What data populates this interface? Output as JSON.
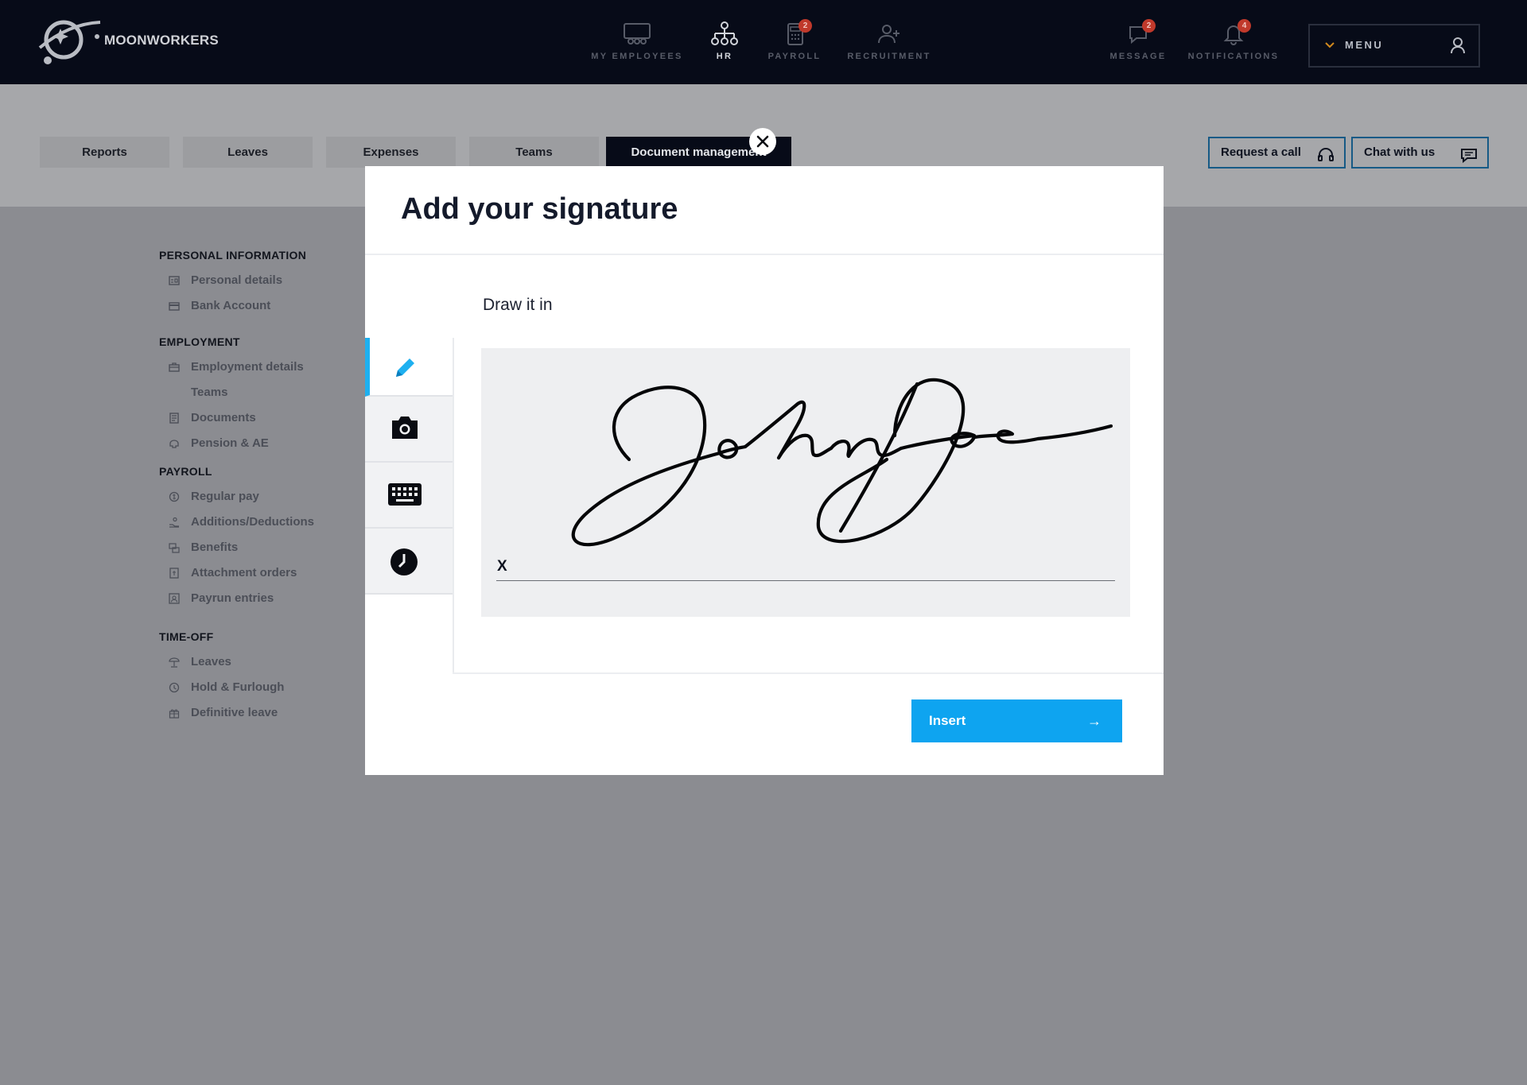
{
  "brand": {
    "name": "MOONWORKERS"
  },
  "top_nav": [
    {
      "id": "employees",
      "label": "MY EMPLOYEES",
      "icon": "team-icon",
      "badge": ""
    },
    {
      "id": "hr",
      "label": "HR",
      "icon": "org-chart-icon",
      "badge": "",
      "active": true
    },
    {
      "id": "payroll",
      "label": "PAYROLL",
      "icon": "calculator-icon",
      "badge": "2"
    },
    {
      "id": "recruitment",
      "label": "RECRUITMENT",
      "icon": "add-user-icon",
      "badge": ""
    }
  ],
  "utility_nav": [
    {
      "id": "message",
      "label": "MESSAGE",
      "icon": "chat-bubble-icon",
      "badge": "2"
    },
    {
      "id": "notifications",
      "label": "NOTIFICATIONS",
      "icon": "bell-icon",
      "badge": "4"
    }
  ],
  "menu": {
    "label": "MENU"
  },
  "tabs": [
    {
      "label": "Reports"
    },
    {
      "label": "Leaves"
    },
    {
      "label": "Expenses"
    },
    {
      "label": "Teams"
    },
    {
      "label": "Document management",
      "active": true
    }
  ],
  "cta": {
    "request_call": "Request a call",
    "chat": "Chat with us"
  },
  "sidebar": {
    "sections": [
      {
        "heading": "PERSONAL INFORMATION",
        "items": [
          "Personal details",
          "Bank Account"
        ]
      },
      {
        "heading": "EMPLOYMENT",
        "items": [
          "Employment details",
          "Teams",
          "Documents",
          "Pension & AE"
        ]
      },
      {
        "heading": "PAYROLL",
        "items": [
          "Regular pay",
          "Additions/Deductions",
          "Benefits",
          "Attachment orders",
          "Payrun entries"
        ]
      },
      {
        "heading": "TIME-OFF",
        "items": [
          "Leaves",
          "Hold & Furlough",
          "Definitive leave"
        ]
      }
    ]
  },
  "modal": {
    "title": "Add your signature",
    "draw_label": "Draw it in",
    "signature_prefix": "X",
    "insert_label": "Insert",
    "insert_arrow": "→",
    "methods": [
      "pencil-icon",
      "camera-icon",
      "keyboard-icon",
      "clock-icon"
    ],
    "active_method": "pencil-icon",
    "signature_text": "John Doe"
  },
  "colors": {
    "accent": "#0ea4f0",
    "topbar": "#070b18",
    "badge": "#c0392b",
    "cta_border": "#165a86"
  }
}
